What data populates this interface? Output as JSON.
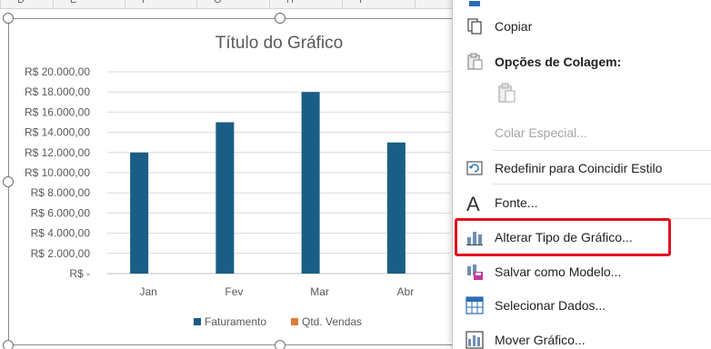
{
  "spreadsheet": {
    "columns": [
      "D",
      "E",
      "F",
      "G",
      "H",
      "I"
    ]
  },
  "chart_data": {
    "type": "bar",
    "title": "Título do Gráfico",
    "categories": [
      "Jan",
      "Fev",
      "Mar",
      "Abr"
    ],
    "series": [
      {
        "name": "Faturamento",
        "values": [
          12000,
          15000,
          18000,
          13000
        ],
        "color": "#1a5e86"
      },
      {
        "name": "Qtd. Vendas",
        "values": [
          0,
          0,
          0,
          0
        ],
        "color": "#e07b39"
      }
    ],
    "ylim": [
      0,
      20000
    ],
    "yticks": [
      "R$ -",
      "R$ 2.000,00",
      "R$ 4.000,00",
      "R$ 6.000,00",
      "R$ 8.000,00",
      "R$ 10.000,00",
      "R$ 12.000,00",
      "R$ 14.000,00",
      "R$ 16.000,00",
      "R$ 18.000,00",
      "R$ 20.000,00"
    ],
    "grid": true,
    "legend_position": "bottom"
  },
  "context_menu": {
    "copy": "Copiar",
    "paste_options": "Opções de Colagem:",
    "paste_special": "Colar Especial...",
    "reset_style": "Redefinir para Coincidir Estilo",
    "font": "Fonte...",
    "change_chart_type": "Alterar Tipo de Gráfico...",
    "save_template": "Salvar como Modelo...",
    "select_data": "Selecionar Dados...",
    "move_chart": "Mover Gráfico..."
  },
  "colors": {
    "highlight": "#e0101e",
    "bar": "#1a5e86",
    "legend_orange": "#e07b39"
  }
}
